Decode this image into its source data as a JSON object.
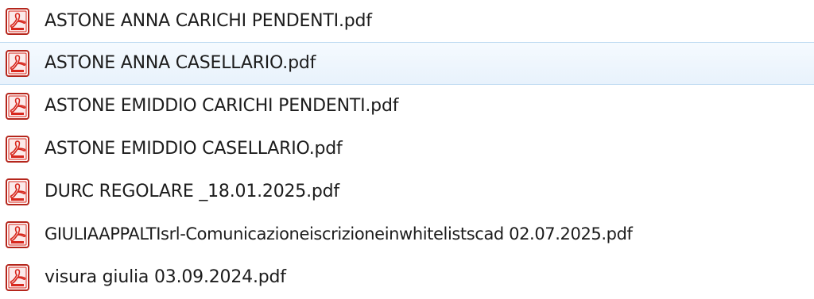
{
  "files": [
    {
      "name": "ASTONE ANNA CARICHI PENDENTI.pdf",
      "icon": "pdf-icon"
    },
    {
      "name": "ASTONE ANNA CASELLARIO.pdf",
      "icon": "pdf-icon"
    },
    {
      "name": "ASTONE EMIDDIO CARICHI PENDENTI.pdf",
      "icon": "pdf-icon"
    },
    {
      "name": "ASTONE EMIDDIO CASELLARIO.pdf",
      "icon": "pdf-icon"
    },
    {
      "name": "DURC REGOLARE _18.01.2025.pdf",
      "icon": "pdf-icon"
    },
    {
      "name": "GIULIAAPPALTIsrl-Comunicazioneiscrizioneinwhitelistscad 02.07.2025.pdf",
      "icon": "pdf-icon"
    },
    {
      "name": "visura giulia 03.09.2024.pdf",
      "icon": "pdf-icon"
    }
  ],
  "colors": {
    "hover_background": "#e8f2fc",
    "hover_border": "#c2dcf2",
    "text": "#1c1c1c",
    "pdf_red": "#d7281e"
  }
}
